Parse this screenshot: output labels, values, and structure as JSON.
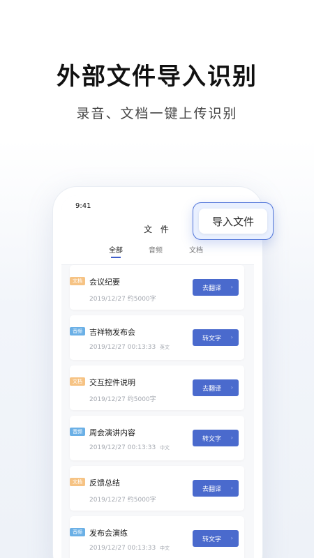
{
  "hero": {
    "title": "外部文件导入识别",
    "subtitle": "录音、文档一键上传识别"
  },
  "phone": {
    "status_time": "9:41",
    "screen_title": "文 件",
    "tabs": [
      {
        "label": "全部",
        "active": true
      },
      {
        "label": "音频",
        "active": false
      },
      {
        "label": "文档",
        "active": false
      }
    ],
    "import_label": "导入文件"
  },
  "items": [
    {
      "badge": "文档",
      "badge_type": "file",
      "title": "会议纪要",
      "date": "2019/12/27",
      "duration": "",
      "length": "约5000字",
      "lang": "",
      "action": "去翻译"
    },
    {
      "badge": "音频",
      "badge_type": "audio",
      "title": "吉祥物发布会",
      "date": "2019/12/27",
      "duration": "00:13:33",
      "length": "",
      "lang": "英文",
      "action": "转文字"
    },
    {
      "badge": "文档",
      "badge_type": "file",
      "title": "交互控件说明",
      "date": "2019/12/27",
      "duration": "",
      "length": "约5000字",
      "lang": "",
      "action": "去翻译"
    },
    {
      "badge": "音频",
      "badge_type": "audio",
      "title": "周会演讲内容",
      "date": "2019/12/27",
      "duration": "00:13:33",
      "length": "",
      "lang": "中文",
      "action": "转文字"
    },
    {
      "badge": "文档",
      "badge_type": "file",
      "title": "反馈总结",
      "date": "2019/12/27",
      "duration": "",
      "length": "约5000字",
      "lang": "",
      "action": "去翻译"
    },
    {
      "badge": "音频",
      "badge_type": "audio",
      "title": "发布会演练",
      "date": "2019/12/27",
      "duration": "00:13:33",
      "length": "",
      "lang": "中文",
      "action": "转文字"
    }
  ],
  "colors": {
    "accent": "#4a6acd",
    "file_badge": "#f6c384",
    "audio_badge": "#6bb0e6"
  }
}
